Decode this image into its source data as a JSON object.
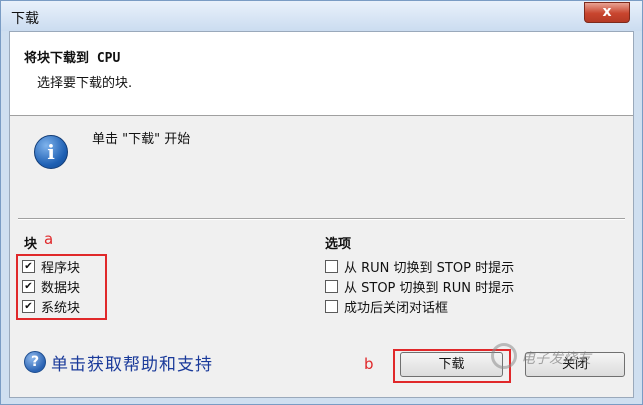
{
  "window": {
    "title": "下载",
    "close_glyph": "x"
  },
  "header": {
    "title": "将块下载到 CPU",
    "subtitle": "选择要下载的块."
  },
  "info": {
    "icon": "info-icon",
    "glyph": "i",
    "text": "单击 \"下载\" 开始"
  },
  "blocks": {
    "heading": "块",
    "annotation": "a",
    "items": [
      {
        "label": "程序块",
        "checked": true
      },
      {
        "label": "数据块",
        "checked": true
      },
      {
        "label": "系统块",
        "checked": true
      }
    ]
  },
  "options": {
    "heading": "选项",
    "items": [
      {
        "label": "从 RUN 切换到 STOP 时提示",
        "checked": false
      },
      {
        "label": "从 STOP 切换到 RUN 时提示",
        "checked": false
      },
      {
        "label": "成功后关闭对话框",
        "checked": false
      }
    ]
  },
  "help": {
    "icon": "question-icon",
    "glyph": "?",
    "label": "单击获取帮助和支持"
  },
  "buttons": {
    "annotation": "b",
    "download": "下载",
    "close": "关闭"
  },
  "watermark": "电子发烧友",
  "colors": {
    "annotation_red": "#e0282a",
    "link_blue": "#1a3a9a"
  }
}
